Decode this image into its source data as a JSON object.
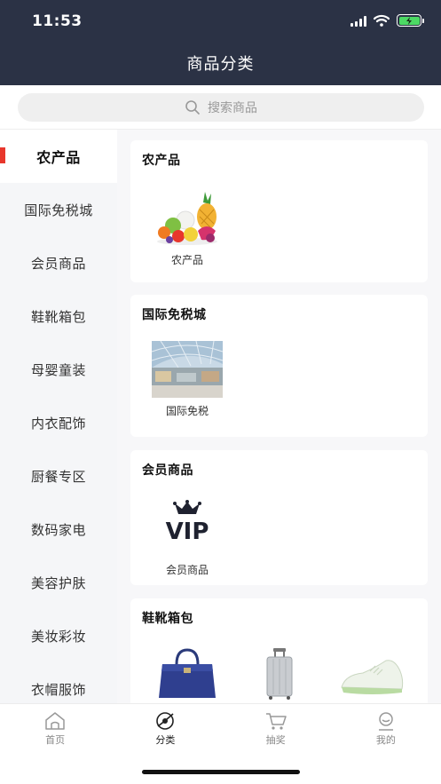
{
  "status": {
    "time": "11:53"
  },
  "header": {
    "title": "商品分类"
  },
  "search": {
    "placeholder": "搜索商品"
  },
  "sidebar": {
    "items": [
      {
        "label": "农产品",
        "active": true
      },
      {
        "label": "国际免税城",
        "active": false
      },
      {
        "label": "会员商品",
        "active": false
      },
      {
        "label": "鞋靴箱包",
        "active": false
      },
      {
        "label": "母婴童装",
        "active": false
      },
      {
        "label": "内衣配饰",
        "active": false
      },
      {
        "label": "厨餐专区",
        "active": false
      },
      {
        "label": "数码家电",
        "active": false
      },
      {
        "label": "美容护肤",
        "active": false
      },
      {
        "label": "美妆彩妆",
        "active": false
      },
      {
        "label": "衣帽服饰",
        "active": false
      }
    ]
  },
  "sections": [
    {
      "title": "农产品",
      "items": [
        {
          "label": "农产品",
          "icon": "fruit-basket-image"
        }
      ]
    },
    {
      "title": "国际免税城",
      "items": [
        {
          "label": "国际免税",
          "icon": "mall-atrium-image"
        }
      ]
    },
    {
      "title": "会员商品",
      "items": [
        {
          "label": "会员商品",
          "icon": "vip-crown-image"
        }
      ]
    },
    {
      "title": "鞋靴箱包",
      "items": [
        {
          "label": "",
          "icon": "handbag-image"
        },
        {
          "label": "",
          "icon": "suitcase-image"
        },
        {
          "label": "",
          "icon": "sneaker-image"
        }
      ]
    }
  ],
  "tabbar": {
    "items": [
      {
        "label": "首页",
        "icon": "home-icon",
        "active": false
      },
      {
        "label": "分类",
        "icon": "category-icon",
        "active": true
      },
      {
        "label": "抽奖",
        "icon": "cart-icon",
        "active": false
      },
      {
        "label": "我的",
        "icon": "profile-icon",
        "active": false
      }
    ]
  },
  "colors": {
    "header_bg": "#2b3245",
    "accent": "#e8372c",
    "battery": "#4cd964"
  }
}
